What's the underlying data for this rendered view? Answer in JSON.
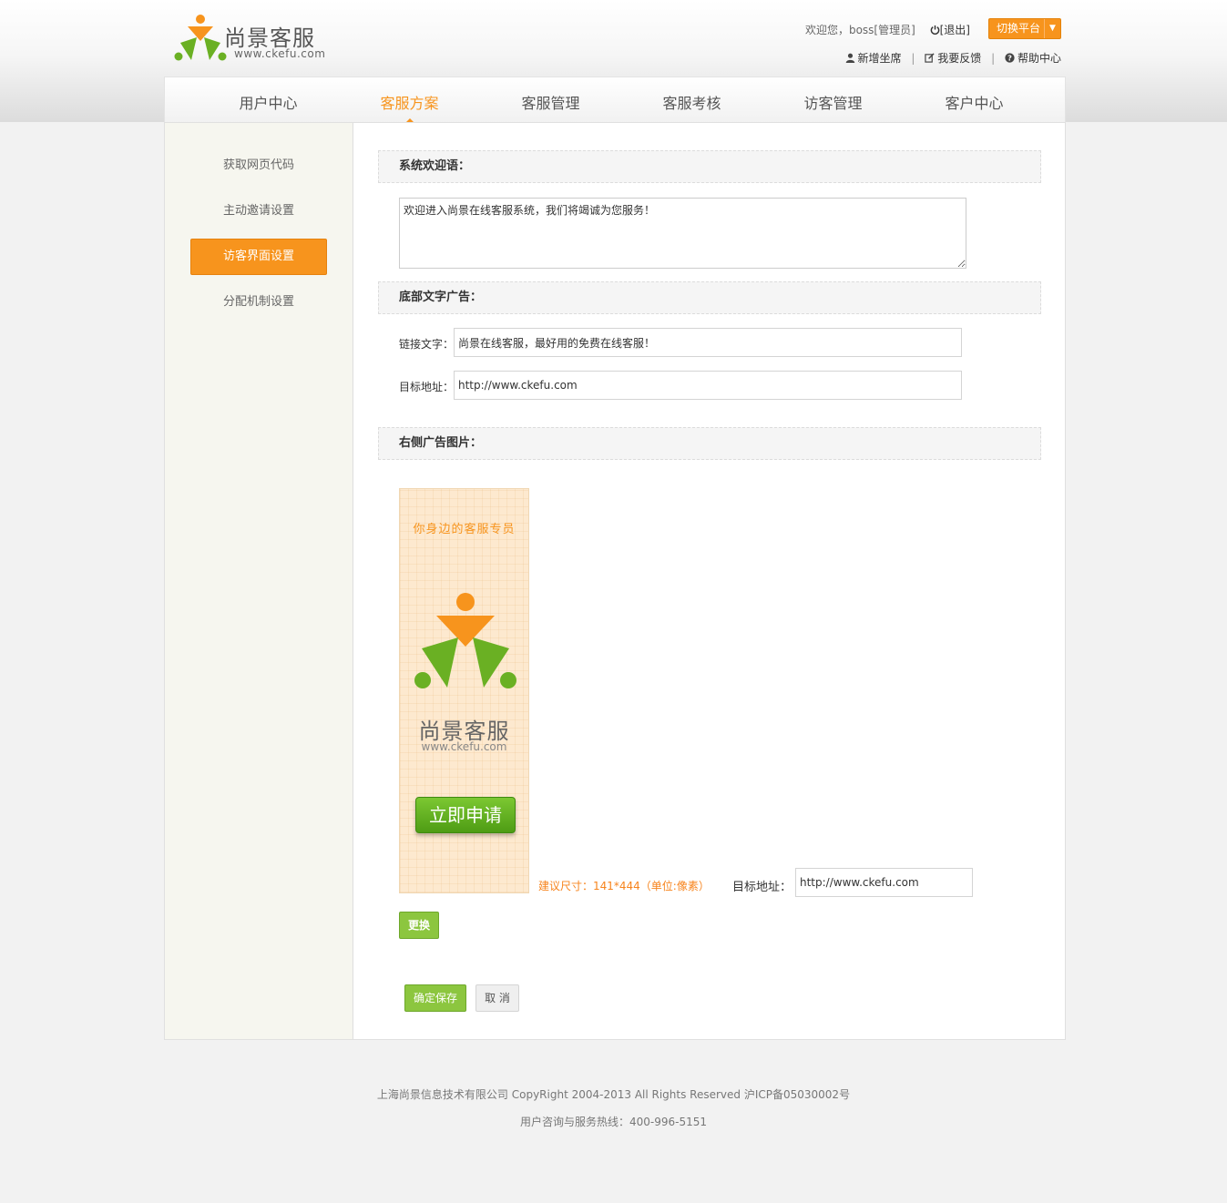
{
  "header": {
    "logo_text": "尚景客服",
    "logo_url": "www.ckefu.com",
    "welcome": "欢迎您，boss[管理员]",
    "logout": "[退出]",
    "switch_platform": "切换平台",
    "links": [
      "新增坐席",
      "我要反馈",
      "帮助中心"
    ]
  },
  "nav": {
    "items": [
      "用户中心",
      "客服方案",
      "客服管理",
      "客服考核",
      "访客管理",
      "客户中心"
    ],
    "active_index": 1
  },
  "sidebar": {
    "items": [
      "获取网页代码",
      "主动邀请设置",
      "访客界面设置",
      "分配机制设置"
    ],
    "active_index": 2
  },
  "sections": {
    "welcome_title": "系统欢迎语：",
    "welcome_text": "欢迎进入尚景在线客服系统，我们将竭诚为您服务！",
    "footer_ad_title": "底部文字广告：",
    "link_text_label": "链接文字：",
    "link_text_value": "尚景在线客服，最好用的免费在线客服！",
    "target_label": "目标地址：",
    "target_value": "http://www.ckefu.com",
    "right_ad_title": "右侧广告图片："
  },
  "ad": {
    "slogan": "你身边的客服专员",
    "brand": "尚景客服",
    "url": "www.ckefu.com",
    "apply": "立即申请",
    "size_hint": "建议尺寸：141*444（单位:像素）",
    "target_label": "目标地址：",
    "target_value": "http://www.ckefu.com",
    "replace_button": "更换"
  },
  "actions": {
    "save": "确定保存",
    "cancel": "取 消"
  },
  "footer": {
    "copyright": "上海尚景信息技术有限公司 CopyRight 2004-2013 All Rights Reserved 沪ICP备05030002号",
    "hotline": "用户咨询与服务热线：400-996-5151"
  },
  "colors": {
    "accent": "#f7941d",
    "green": "#8cc63f",
    "logo_green": "#6ab023"
  }
}
